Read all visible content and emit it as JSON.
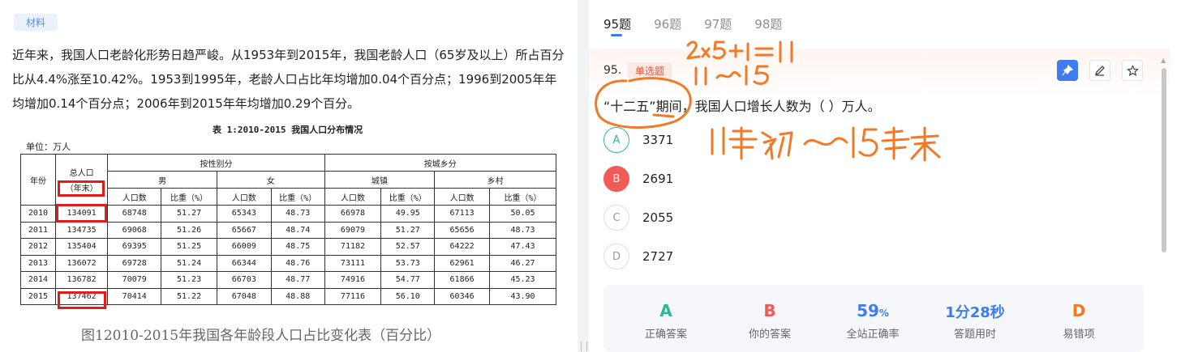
{
  "material": {
    "tag": "材料",
    "paragraph": "近年来，我国人口老龄化形势日趋严峻。从1953年到2015年，我国老龄人口（65岁及以上）所占百分比从4.4%涨至10.42%。1953到1995年，老龄人口占比年均增加0.04个百分点；1996到2005年年均增加0.14个百分点；2006年到2015年年均增加0.29个百分。"
  },
  "table": {
    "title": "表 1:2010-2015 我国人口分布情况",
    "unit": "单位：万人",
    "header": {
      "year": "年份",
      "total_line1": "总人口",
      "total_line2": "（年末）",
      "by_gender": "按性别分",
      "by_region": "按城乡分",
      "male": "男",
      "female": "女",
      "urban": "城镇",
      "rural": "乡村",
      "pop_count": "人口数",
      "share": "比重（%）"
    },
    "rows": [
      [
        "2010",
        "134091",
        "68748",
        "51.27",
        "65343",
        "48.73",
        "66978",
        "49.95",
        "67113",
        "50.05"
      ],
      [
        "2011",
        "134735",
        "69068",
        "51.26",
        "65667",
        "48.74",
        "69079",
        "51.27",
        "65656",
        "48.73"
      ],
      [
        "2012",
        "135404",
        "69395",
        "51.25",
        "66009",
        "48.75",
        "71182",
        "52.57",
        "64222",
        "47.43"
      ],
      [
        "2013",
        "136072",
        "69728",
        "51.24",
        "66344",
        "48.76",
        "73111",
        "53.73",
        "62961",
        "46.27"
      ],
      [
        "2014",
        "136782",
        "70079",
        "51.23",
        "66703",
        "48.77",
        "74916",
        "54.77",
        "61866",
        "45.23"
      ],
      [
        "2015",
        "137462",
        "70414",
        "51.22",
        "67048",
        "48.88",
        "77116",
        "56.10",
        "60346",
        "43.90"
      ]
    ],
    "caption": "图12010-2015年我国各年龄段人口占比变化表（百分比）"
  },
  "tabs": [
    "95题",
    "96题",
    "97题",
    "98题"
  ],
  "active_tab": 0,
  "question": {
    "number": "95.",
    "type": "单选题",
    "stem": "“十二五”期间，我国人口增长人数为（ ）万人。",
    "options": [
      {
        "letter": "A",
        "text": "3371",
        "state": "correct"
      },
      {
        "letter": "B",
        "text": "2691",
        "state": "wrong"
      },
      {
        "letter": "C",
        "text": "2055",
        "state": "normal"
      },
      {
        "letter": "D",
        "text": "2727",
        "state": "normal"
      }
    ]
  },
  "stats": [
    {
      "value": "A",
      "unit": "",
      "label": "正确答案",
      "color": "#2cb894"
    },
    {
      "value": "B",
      "unit": "",
      "label": "你的答案",
      "color": "#f25b55"
    },
    {
      "value": "59",
      "unit": "%",
      "label": "全站正确率",
      "color": "#3f7cf0"
    },
    {
      "value": "1分28秒",
      "unit": "",
      "label": "答题用时",
      "color": "#3f7cf0"
    },
    {
      "value": "D",
      "unit": "",
      "label": "易错项",
      "color": "#f07a28"
    }
  ],
  "colors": {
    "accent": "#3f7cf0",
    "correct": "#2cb894",
    "wrong": "#f25b55",
    "ink": "#f07a28",
    "highlight": "#e41b1b"
  }
}
